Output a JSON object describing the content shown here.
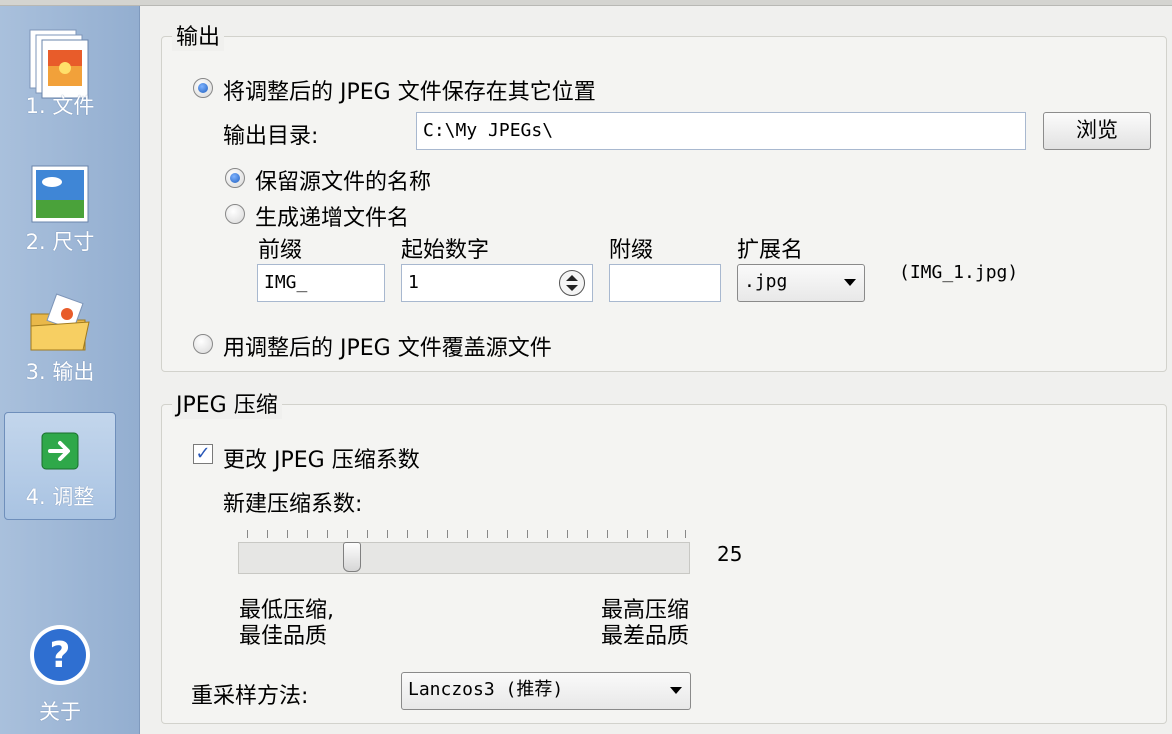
{
  "sidebar": {
    "items": [
      {
        "label": "1. 文件",
        "icon": "files-icon"
      },
      {
        "label": "2. 尺寸",
        "icon": "image-size-icon"
      },
      {
        "label": "3. 输出",
        "icon": "output-folder-icon"
      },
      {
        "label": "4. 调整",
        "icon": "arrow-right-icon"
      }
    ],
    "about_label": "关于",
    "active_index": 3
  },
  "output": {
    "title": "输出",
    "save_elsewhere_label": "将调整后的 JPEG 文件保存在其它位置",
    "dir_label": "输出目录:",
    "dir_value": "C:\\My JPEGs\\",
    "browse_label": "浏览",
    "keep_name_label": "保留源文件的名称",
    "incremental_label": "生成递增文件名",
    "prefix_header": "前缀",
    "start_header": "起始数字",
    "suffix_header": "附缀",
    "ext_header": "扩展名",
    "prefix_value": "IMG_",
    "start_value": "1",
    "suffix_value": "",
    "ext_value": ".jpg",
    "preview_name": "(IMG_1.jpg)",
    "overwrite_label": "用调整后的 JPEG 文件覆盖源文件"
  },
  "compression": {
    "title": "JPEG 压缩",
    "change_label": "更改 JPEG 压缩系数",
    "change_checked": true,
    "new_factor_label": "新建压缩系数:",
    "slider_value": "25",
    "min_label_line1": "最低压缩,",
    "min_label_line2": "最佳品质",
    "max_label_line1": "最高压缩",
    "max_label_line2": "最差品质",
    "resample_label": "重采样方法:",
    "resample_value": "Lanczos3 (推荐)"
  }
}
